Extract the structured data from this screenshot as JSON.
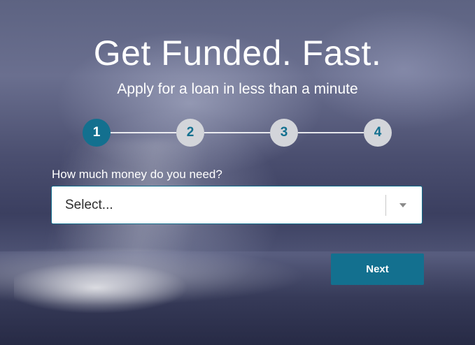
{
  "hero": {
    "title": "Get Funded. Fast.",
    "subtitle": "Apply for a loan in less than a minute"
  },
  "stepper": {
    "steps": [
      {
        "label": "1",
        "state": "active"
      },
      {
        "label": "2",
        "state": "inactive"
      },
      {
        "label": "3",
        "state": "inactive"
      },
      {
        "label": "4",
        "state": "inactive"
      }
    ]
  },
  "form": {
    "amount_label": "How much money do you need?",
    "amount_value": "Select..."
  },
  "actions": {
    "next_label": "Next"
  },
  "colors": {
    "accent": "#13708f",
    "inactive_step": "#d3d5da"
  }
}
